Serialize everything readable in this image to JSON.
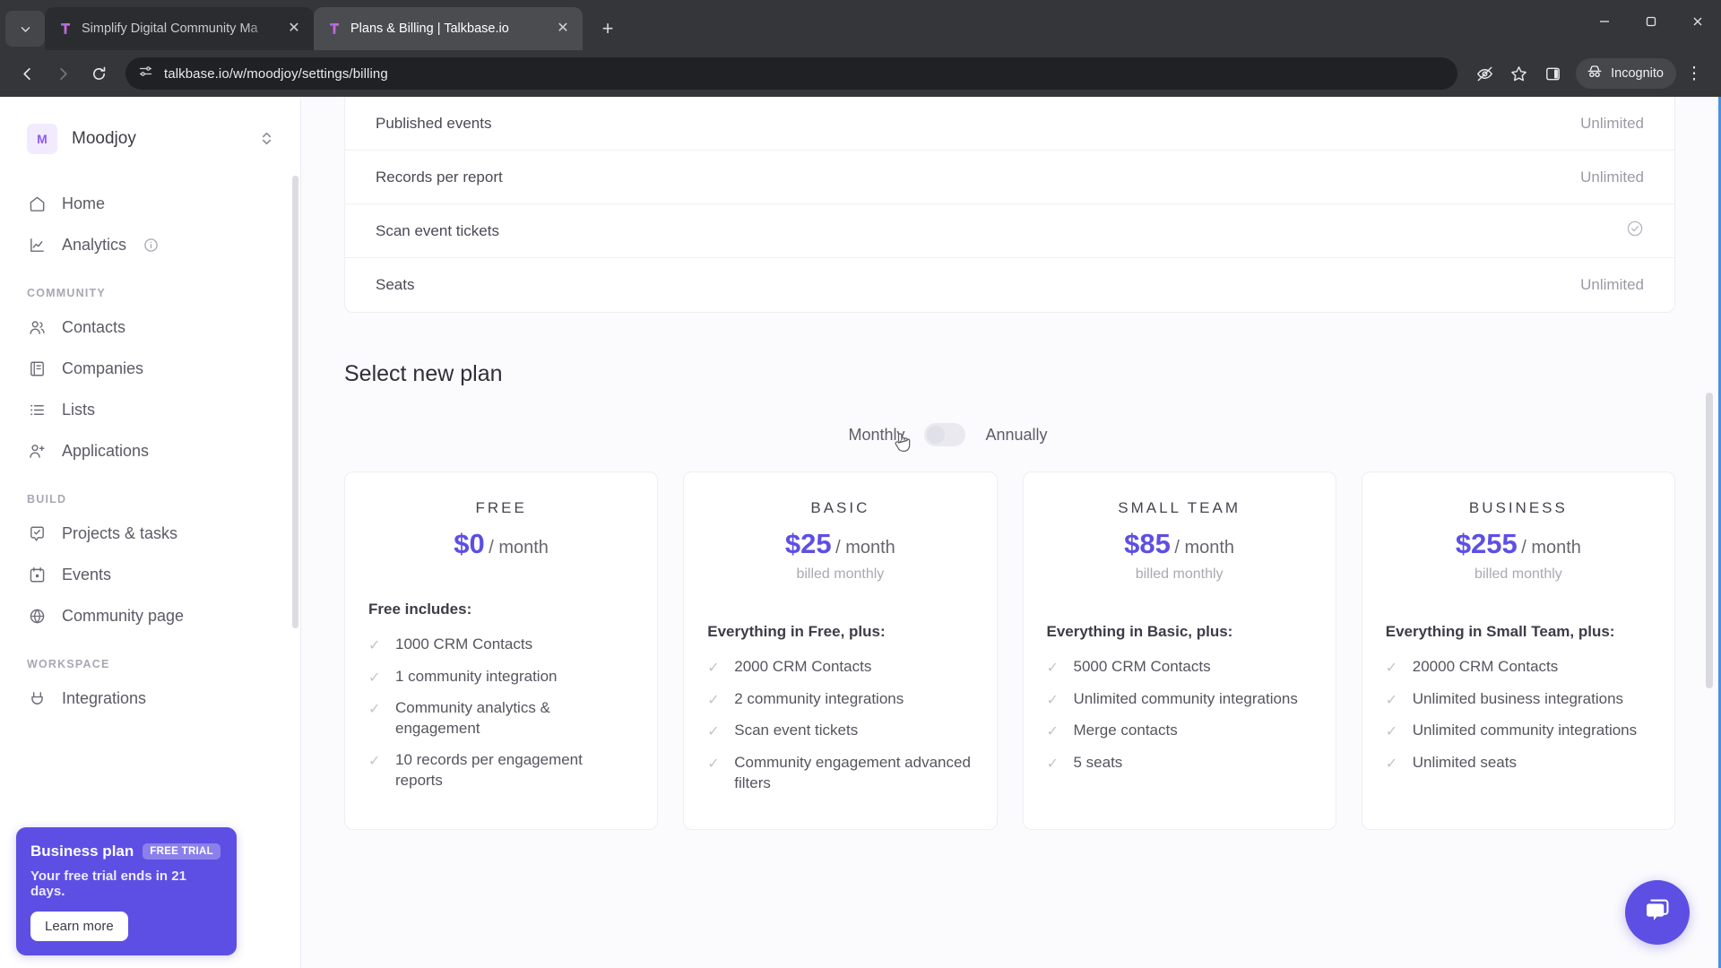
{
  "browser": {
    "tabs": [
      {
        "title": "Simplify Digital Community Ma",
        "active": false
      },
      {
        "title": "Plans & Billing | Talkbase.io",
        "active": true
      }
    ],
    "new_tab_label": "+",
    "tab_list_icon": "chevron-down-icon",
    "close_icon": "✕",
    "window_controls": {
      "minimize": "─",
      "maximize": "☐",
      "close": "✕"
    },
    "nav": {
      "back": "←",
      "forward": "→",
      "reload": "↻"
    },
    "omnibox": {
      "url": "talkbase.io/w/moodjoy/settings/billing",
      "site_info_icon": "site-settings-icon"
    },
    "toolbar_icons": [
      "eye-off-icon",
      "star-icon",
      "side-panel-icon"
    ],
    "profile": {
      "label": "Incognito",
      "icon": "incognito-icon"
    },
    "menu_icon": "⋮"
  },
  "sidebar": {
    "workspace": {
      "initial": "M",
      "name": "Moodjoy",
      "chevron": "⌃⌄"
    },
    "items": [
      {
        "label": "Home",
        "icon": "home-icon",
        "group": null,
        "info": false
      },
      {
        "label": "Analytics",
        "icon": "chart-line-icon",
        "group": null,
        "info": true
      }
    ],
    "groups": [
      {
        "title": "COMMUNITY",
        "items": [
          {
            "label": "Contacts",
            "icon": "users-icon"
          },
          {
            "label": "Companies",
            "icon": "building-icon"
          },
          {
            "label": "Lists",
            "icon": "list-icon"
          },
          {
            "label": "Applications",
            "icon": "user-plus-icon"
          }
        ]
      },
      {
        "title": "BUILD",
        "items": [
          {
            "label": "Projects & tasks",
            "icon": "check-square-icon"
          },
          {
            "label": "Events",
            "icon": "calendar-icon"
          },
          {
            "label": "Community page",
            "icon": "globe-icon"
          }
        ]
      },
      {
        "title": "WORKSPACE",
        "items": [
          {
            "label": "Integrations",
            "icon": "plug-icon"
          }
        ]
      }
    ],
    "promo": {
      "title": "Business plan",
      "badge": "FREE TRIAL",
      "subtitle": "Your free trial ends in 21 days.",
      "button": "Learn more"
    }
  },
  "main": {
    "feature_table": {
      "rows": [
        {
          "label": "Published events",
          "value": "Unlimited",
          "type": "text"
        },
        {
          "label": "Records per report",
          "value": "Unlimited",
          "type": "text"
        },
        {
          "label": "Scan event tickets",
          "value": "✓",
          "type": "check"
        },
        {
          "label": "Seats",
          "value": "Unlimited",
          "type": "text"
        }
      ]
    },
    "section_title": "Select new plan",
    "billing_toggle": {
      "left_label": "Monthly",
      "right_label": "Annually",
      "selected": "Monthly"
    },
    "plans": [
      {
        "name": "FREE",
        "amount": "$0",
        "period": "/ month",
        "billed": "",
        "includes": "Free includes:",
        "features": [
          "1000 CRM Contacts",
          "1 community integration",
          "Community analytics & engagement",
          "10 records per engagement reports"
        ]
      },
      {
        "name": "BASIC",
        "amount": "$25",
        "period": "/ month",
        "billed": "billed monthly",
        "includes": "Everything in Free, plus:",
        "features": [
          "2000 CRM Contacts",
          "2 community integrations",
          "Scan event tickets",
          "Community engagement advanced filters"
        ]
      },
      {
        "name": "SMALL TEAM",
        "amount": "$85",
        "period": "/ month",
        "billed": "billed monthly",
        "includes": "Everything in Basic, plus:",
        "features": [
          "5000 CRM Contacts",
          "Unlimited community integrations",
          "Merge contacts",
          "5 seats"
        ]
      },
      {
        "name": "BUSINESS",
        "amount": "$255",
        "period": "/ month",
        "billed": "billed monthly",
        "includes": "Everything in Small Team, plus:",
        "features": [
          "20000 CRM Contacts",
          "Unlimited business integrations",
          "Unlimited community integrations",
          "Unlimited seats"
        ]
      }
    ],
    "chat_widget_icon": "chat-bubble-icon"
  },
  "colors": {
    "accent": "#5d4fe3",
    "chrome_bg": "#35363a",
    "page_bg": "#fbfbfe",
    "focus_border": "#4a90e2"
  }
}
